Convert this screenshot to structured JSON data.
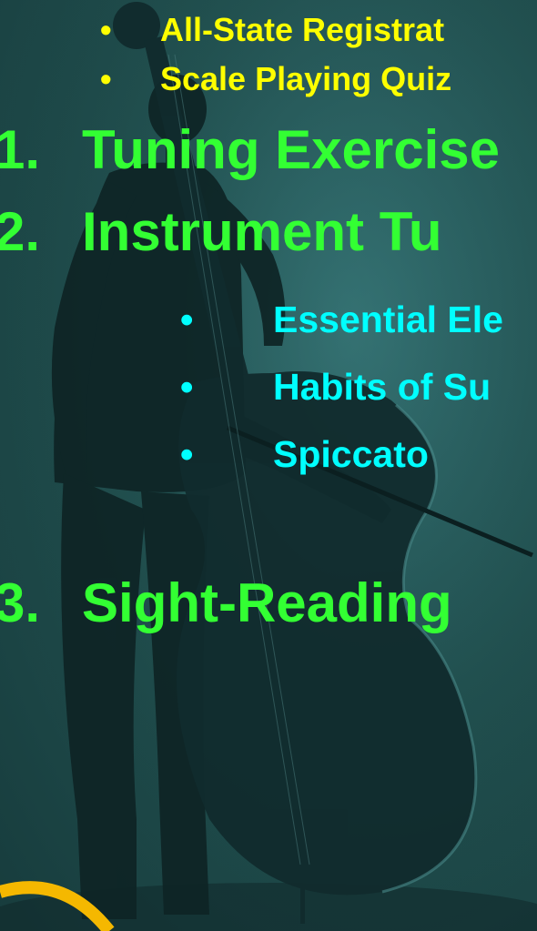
{
  "top_bullets": [
    "All-State Registrat",
    "Scale Playing Quiz"
  ],
  "numbered_items": [
    {
      "number": "1.",
      "label": "Tuning Exercise"
    },
    {
      "number": "2.",
      "label": "Instrument Tu"
    },
    {
      "number": "3.",
      "label": "Sight-Reading"
    }
  ],
  "sub_bullets": [
    "Essential Ele",
    "Habits of Su",
    "Spiccato"
  ],
  "bullet_glyph": "•",
  "colors": {
    "yellow_text": "#ffff00",
    "green_text": "#33ff33",
    "cyan_text": "#00ffff",
    "background": "#1f4a4d",
    "accent_arc": "#f5b800"
  }
}
